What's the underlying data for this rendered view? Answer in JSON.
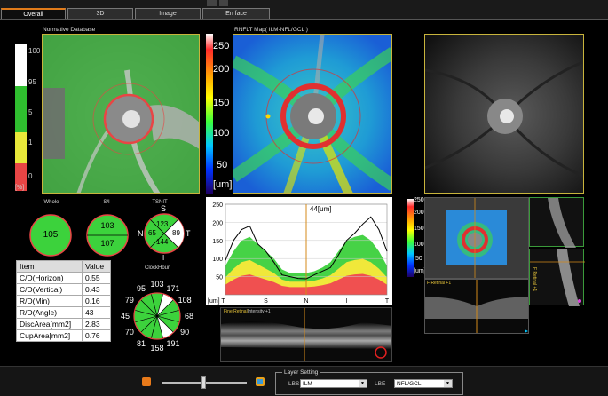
{
  "tabs": [
    {
      "label": "Overall",
      "active": true
    },
    {
      "label": "3D",
      "active": false
    },
    {
      "label": "Image",
      "active": false
    },
    {
      "label": "En face",
      "active": false
    }
  ],
  "normative": {
    "title": "Normative Database",
    "scale_labels": [
      "100",
      "95",
      "5",
      "1",
      "0"
    ],
    "unit": "[%]",
    "colors": {
      "white": "#ffffff",
      "green": "#2fbf2f",
      "yellow": "#e8e83a",
      "red": "#e84545"
    }
  },
  "rnfl": {
    "title": "RNFLT Map( ILM-NFL/GCL )",
    "scale_labels": [
      "250",
      "200",
      "150",
      "100",
      "50",
      "[um]"
    ]
  },
  "circles": {
    "whole": {
      "label": "Whole",
      "value": "105"
    },
    "si": {
      "label": "S/I",
      "top": "103",
      "bottom": "107"
    },
    "tsnit": {
      "label": "TSNIT",
      "S": "S",
      "N": "N",
      "T": "T",
      "I": "I",
      "s_val": "123",
      "n_val": "65",
      "t_val": "89",
      "i_val": "144"
    },
    "clockhour": {
      "label": "ClockHour",
      "values": [
        "103",
        "171",
        "108",
        "68",
        "90",
        "191",
        "158",
        "81",
        "70",
        "45",
        "79",
        "95"
      ]
    }
  },
  "params_table": {
    "header": {
      "item": "Item",
      "value": "Value"
    },
    "rows": [
      {
        "item": "C/D(Horizon)",
        "value": "0.55"
      },
      {
        "item": "C/D(Vertical)",
        "value": "0.43"
      },
      {
        "item": "R/D(Min)",
        "value": "0.16"
      },
      {
        "item": "R/D(Angle)",
        "value": "43"
      },
      {
        "item": "DiscArea[mm2]",
        "value": "2.83"
      },
      {
        "item": "CupArea[mm2]",
        "value": "0.76"
      }
    ]
  },
  "chart_data": {
    "type": "line",
    "title": "",
    "cursor_label": "44[um]",
    "ylim": [
      0,
      250
    ],
    "yticks": [
      "250",
      "200",
      "150",
      "100",
      "50"
    ],
    "xticks": [
      "[um] T",
      "S",
      "N",
      "I",
      "T"
    ],
    "x": [
      0,
      5,
      10,
      15,
      20,
      25,
      30,
      35,
      40,
      45,
      50,
      55,
      60,
      65,
      70,
      75,
      80,
      85,
      90,
      95,
      100
    ],
    "series": [
      {
        "values": [
          95,
          150,
          180,
          190,
          140,
          120,
          90,
          55,
          50,
          45,
          44,
          55,
          65,
          75,
          110,
          150,
          170,
          195,
          215,
          180,
          120
        ]
      }
    ],
    "normative_band_top": [
      80,
      120,
      150,
      160,
      140,
      120,
      100,
      70,
      60,
      60,
      60,
      65,
      75,
      90,
      120,
      150,
      160,
      165,
      150,
      120,
      80
    ]
  },
  "bscan": {
    "label": "Fine Retinal",
    "sub": "Intensity +1"
  },
  "mini": {
    "scale_labels": [
      "250",
      "200",
      "150",
      "100",
      "50",
      "[um]"
    ],
    "bscan_label": "F Retinal +1",
    "vert_label": "F Retinal +1"
  },
  "layer_setting": {
    "title": "Layer Setting",
    "lbs_label": "LBS",
    "lbs_value": "ILM",
    "lbe_label": "LBE",
    "lbe_value": "NFL/GCL"
  }
}
